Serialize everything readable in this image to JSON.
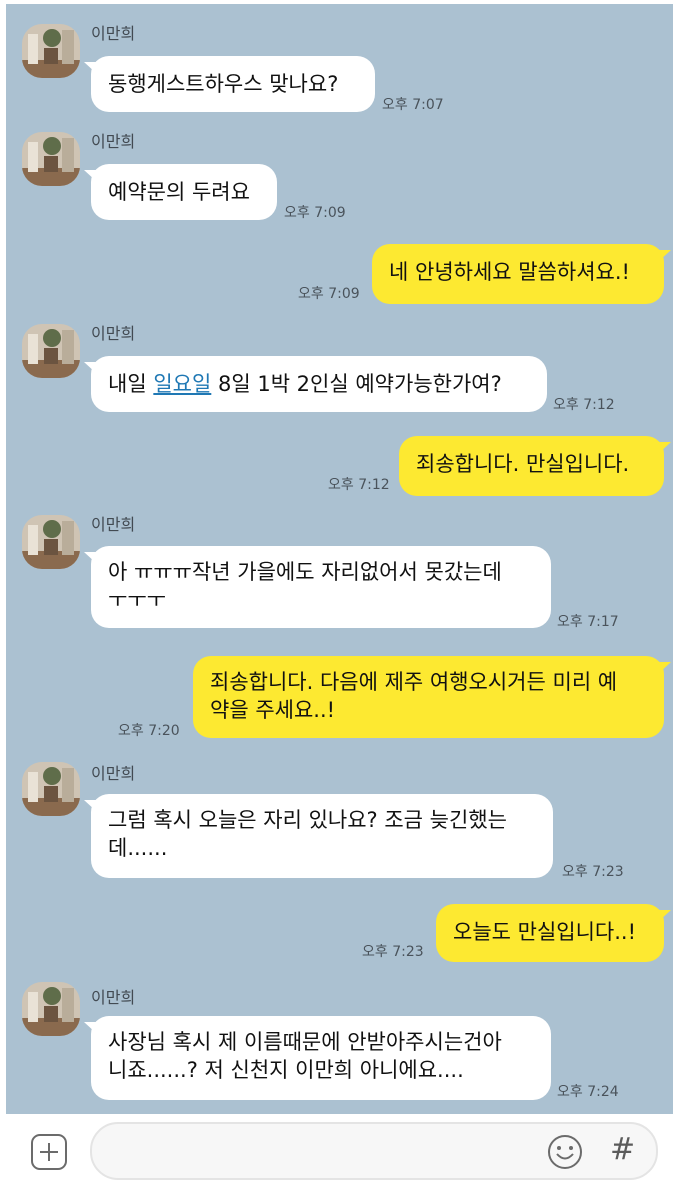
{
  "chat": {
    "sender_name": "이만희",
    "messages": [
      {
        "from": "in",
        "text": "동행게스트하우스 맞나요?",
        "time": "오후 7:07"
      },
      {
        "from": "in",
        "text": "예약문의 두려요",
        "time": "오후 7:09"
      },
      {
        "from": "out",
        "text": "네 안녕하세요 말씀하셔요.!",
        "time": "오후 7:09"
      },
      {
        "from": "in",
        "text_before": "내일 ",
        "link": "일요일",
        "text_after": " 8일 1박 2인실 예약가능한가여?",
        "time": "오후 7:12"
      },
      {
        "from": "out",
        "text": "죄송합니다. 만실입니다.",
        "time": "오후 7:12"
      },
      {
        "from": "in",
        "lines": [
          "아 ㅠㅠㅠ작년 가을에도 자리없어서 못갔는데",
          "ㅜㅜㅜ"
        ],
        "time": "오후 7:17"
      },
      {
        "from": "out",
        "lines": [
          "죄송합니다. 다음에 제주 여행오시거든 미리 예",
          "약을 주세요..!"
        ],
        "time": "오후 7:20"
      },
      {
        "from": "in",
        "lines": [
          "그럼 혹시 오늘은 자리 있나요? 조금 늦긴했는",
          "데......"
        ],
        "time": "오후 7:23"
      },
      {
        "from": "out",
        "text": "오늘도 만실입니다..!",
        "time": "오후 7:23"
      },
      {
        "from": "in",
        "lines": [
          "사장님 혹시 제 이름때문에 안받아주시는건아",
          "니죠......? 저 신천지 이만희 아니에요...."
        ],
        "time": "오후 7:24"
      }
    ]
  },
  "input_bar": {
    "message_value": "",
    "plus_icon": "plus-icon",
    "emoji_icon": "emoji-icon",
    "hash_label": "#"
  },
  "colors": {
    "chat_background": "#abc1d1",
    "incoming_bubble": "#ffffff",
    "outgoing_bubble": "#fde931",
    "link": "#1f78b4"
  }
}
